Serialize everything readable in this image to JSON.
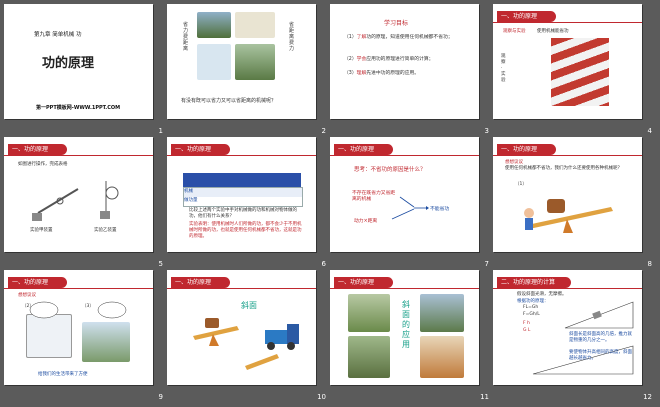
{
  "slides": [
    {
      "n": "1",
      "chapter": "第九章 简单机械 功",
      "title": "功的原理",
      "footer": "第一PPT模板网-WWW.1PPT.COM"
    },
    {
      "n": "2",
      "left_label": "省力费距离",
      "right_label": "省距离费力",
      "question": "有没有既可以省力又可以省距离的机械呢？"
    },
    {
      "n": "3",
      "heading": "学习目标",
      "item1a": "（1）",
      "item1b": "了解",
      "item1c": "功的原理，知道使用任何机械都不省功；",
      "item2a": "（2）",
      "item2b": "学会",
      "item2c": "应用功的原理进行简单的计算；",
      "item3a": "（3）",
      "item3b": "理解",
      "item3c": "先进中功的原理的应用。"
    },
    {
      "n": "4",
      "banner": "一、功的原理",
      "sub_red": "观察与实验",
      "sub_dark": "使用机械能省功",
      "side": "观察·实验"
    },
    {
      "n": "5",
      "banner": "一、功的原理",
      "text": "如图进行操作，完成表格",
      "cap1": "实验甲装置",
      "cap2": "实验乙装置"
    },
    {
      "n": "6",
      "banner": "一、功的原理",
      "row1": "机械",
      "row2": "做功量",
      "p1": "比较上述两个实验中手对机械做的功和机械对物体做的功，他们有什么关系？",
      "p2": "实验表明：使用机械时人们所做的功，都不会少于不用机械时所做的功，也就是使用任何机械都不省功，这就是功的原理。"
    },
    {
      "n": "7",
      "banner": "一、功的原理",
      "question": "思考：不省功的原因是什么？",
      "box1": "不存在既省力又省距离的机械",
      "box2": "动力×距离",
      "conclusion": "不能省功"
    },
    {
      "n": "8",
      "banner": "一、功的原理",
      "sub_red": "想想议议",
      "text": "使用任何机械都不省功，我们为什么还要使用各种机械呢？",
      "item": "（1）"
    },
    {
      "n": "9",
      "banner": "一、功的原理",
      "sub_red": "想想议议",
      "i2": "（2）",
      "i3": "（3）",
      "footer": "给我们的生活带来了方便"
    },
    {
      "n": "10",
      "banner": "一、功的原理",
      "label": "斜面"
    },
    {
      "n": "11",
      "banner": "一、功的原理",
      "vertical": "斜面的应用"
    },
    {
      "n": "12",
      "banner": "二、功的原理的计算",
      "line1": "假设斜面光滑，无摩擦。",
      "line2": "根据功的原理：",
      "f1": "FL=Gh",
      "f2": "F=Gh/L",
      "f3": "F h",
      "f4": "G L",
      "note1": "斜面长是斜面高的几倍，推力就是物重的几分之一。",
      "note2": "要使物体升高相同的高度，斜面越长越省力。"
    }
  ]
}
